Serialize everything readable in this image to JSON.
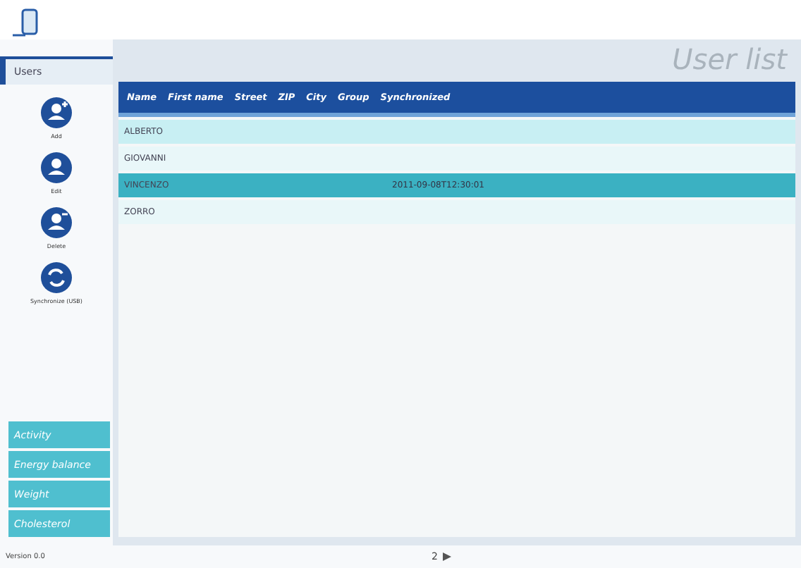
{
  "sidebar": {
    "tab": {
      "label": "Users",
      "selected": true
    },
    "actions": [
      {
        "label": "Add",
        "kind": "add"
      },
      {
        "label": "Edit",
        "kind": "edit"
      },
      {
        "label": "Delete",
        "kind": "delete"
      },
      {
        "label": "Synchronize (USB)",
        "kind": "sync"
      }
    ],
    "sections": [
      {
        "label": "Activity"
      },
      {
        "label": "Energy balance"
      },
      {
        "label": "Weight"
      },
      {
        "label": "Cholesterol"
      }
    ]
  },
  "main": {
    "title": "User list",
    "table": {
      "columns": [
        "Name",
        "First name",
        "Street",
        "ZIP",
        "City",
        "Group",
        "Synchronized"
      ],
      "rows": [
        {
          "name": "ALBERTO",
          "synchronized": "",
          "selected": false
        },
        {
          "name": "GIOVANNI",
          "synchronized": "",
          "selected": false
        },
        {
          "name": "VINCENZO",
          "synchronized": "2011-09-08T12:30:01",
          "selected": true
        },
        {
          "name": "ZORRO",
          "synchronized": "",
          "selected": false
        }
      ]
    }
  },
  "status_bar": {
    "version": "Version 0.0",
    "page": "2"
  }
}
